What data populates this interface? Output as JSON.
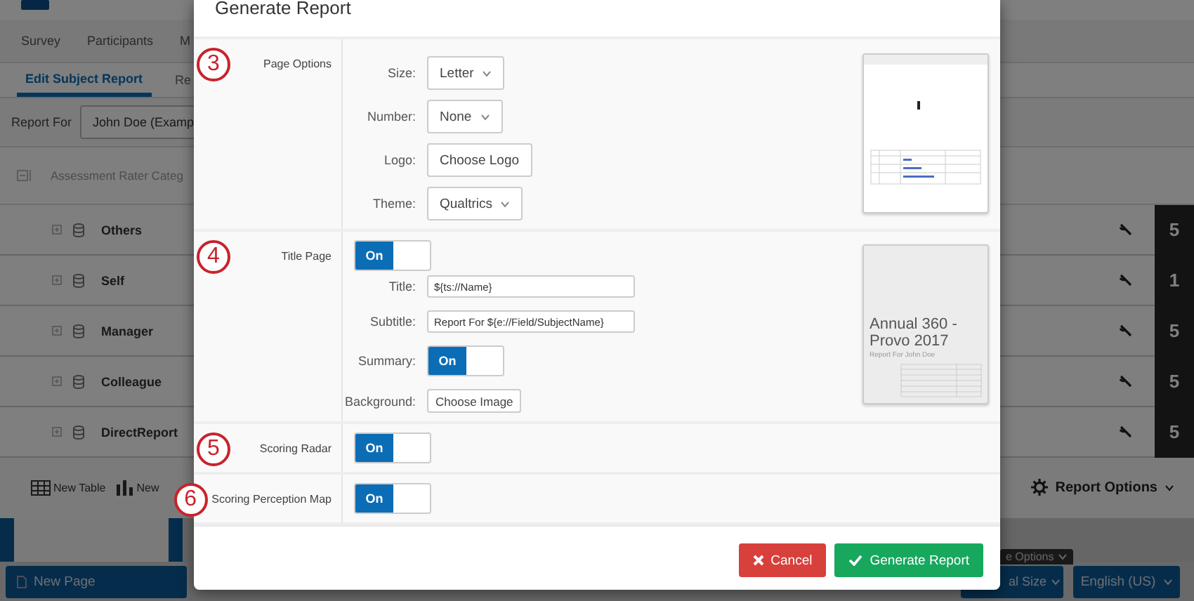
{
  "app": {
    "nav_tabs": [
      {
        "label": "Survey",
        "selected": false
      },
      {
        "label": "Participants",
        "selected": false
      },
      {
        "label": "M",
        "selected": false
      }
    ],
    "sub_tabs": [
      {
        "label": "Edit Subject Report",
        "selected": true
      },
      {
        "label": "Re",
        "selected": false
      }
    ],
    "report_for": {
      "label": "Report For",
      "value": "John Doe (Examp"
    },
    "table": {
      "header": "Assessment Rater Categ",
      "rows": [
        {
          "name": "Others",
          "count": "5"
        },
        {
          "name": "Self",
          "count": "1"
        },
        {
          "name": "Manager",
          "count": "5"
        },
        {
          "name": "Colleague",
          "count": "5"
        },
        {
          "name": "DirectReport",
          "count": "5"
        }
      ]
    },
    "toolbar": {
      "items": [
        {
          "kind": "table",
          "label": "New Table"
        },
        {
          "kind": "chart",
          "label": "New"
        }
      ],
      "report_options": "Report Options"
    },
    "bottom_bar": {
      "new_page": "New Page",
      "tooltip": "e Options",
      "size_select": "al Size",
      "language_select": "English (US)"
    }
  },
  "modal": {
    "title": "Generate Report",
    "sections": [
      {
        "step": "3",
        "label": "Page Options",
        "fields": [
          {
            "kind": "select",
            "label": "Size:",
            "value": "Letter"
          },
          {
            "kind": "select",
            "label": "Number:",
            "value": "None"
          },
          {
            "kind": "button",
            "label": "Logo:",
            "value": "Choose Logo"
          },
          {
            "kind": "select",
            "label": "Theme:",
            "value": "Qualtrics"
          }
        ],
        "preview": {
          "kind": "table"
        }
      },
      {
        "step": "4",
        "label": "Title Page",
        "toggle": {
          "label": "On",
          "on": true
        },
        "fields": [
          {
            "kind": "text",
            "label": "Title:",
            "value": "${ts://Name}"
          },
          {
            "kind": "text",
            "label": "Subtitle:",
            "value": "Report For ${e://Field/SubjectName}"
          },
          {
            "kind": "toggle",
            "label": "Summary:",
            "value": "On",
            "on": true
          },
          {
            "kind": "button",
            "label": "Background:",
            "value": "Choose Image"
          }
        ],
        "preview": {
          "kind": "cover",
          "title": "Annual 360 - Provo 2017",
          "subtitle": "Report For John Doe"
        }
      },
      {
        "step": "5",
        "label": "Scoring Radar",
        "toggle": {
          "label": "On",
          "on": true
        }
      },
      {
        "step": "6",
        "label": "Scoring Perception Map",
        "toggle": {
          "label": "On",
          "on": true
        }
      }
    ],
    "buttons": [
      {
        "kind": "cancel",
        "label": "Cancel"
      },
      {
        "kind": "confirm",
        "label": "Generate Report"
      }
    ]
  }
}
